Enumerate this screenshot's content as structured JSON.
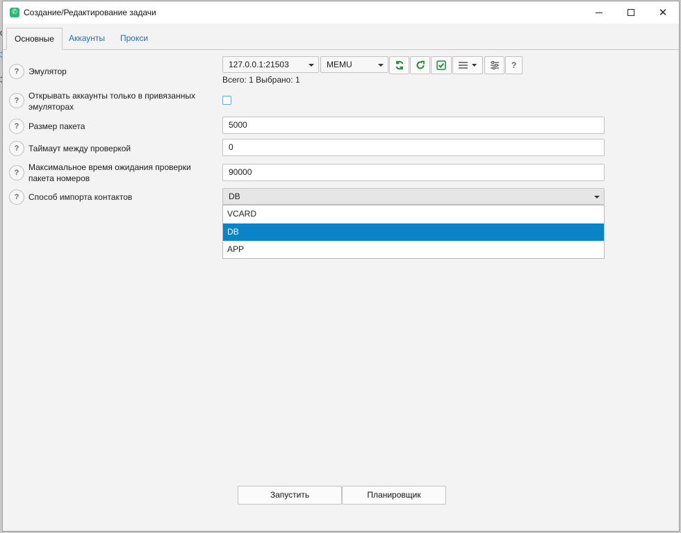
{
  "background": {
    "glyph_1": "ф",
    "glyph_2": "З",
    "glyph_3": "З"
  },
  "window": {
    "title": "Создание/Редактирование задачи"
  },
  "tabs": [
    {
      "label": "Основные",
      "active": true
    },
    {
      "label": "Аккаунты",
      "active": false
    },
    {
      "label": "Прокси",
      "active": false
    }
  ],
  "form": {
    "emulator": {
      "label": "Эмулятор",
      "address_value": "127.0.0.1:21503",
      "type_value": "MEMU",
      "summary": "Всего: 1 Выбрано: 1",
      "tools": [
        "refresh-all-icon",
        "reload-icon",
        "check-all-icon",
        "list-menu-icon",
        "settings-sliders-icon",
        "help-icon"
      ],
      "help_glyph": "?"
    },
    "bound_only": {
      "label": "Открывать аккаунты только в привязанных эмуляторах",
      "checked": false
    },
    "packet_size": {
      "label": "Размер пакета",
      "value": "5000"
    },
    "timeout": {
      "label": "Таймаут между проверкой",
      "value": "0"
    },
    "max_wait": {
      "label": "Максимальное время ожидания проверки пакета номеров",
      "value": "90000"
    },
    "import_method": {
      "label": "Способ импорта контактов",
      "value": "DB",
      "options": [
        "VCARD",
        "DB",
        "APP"
      ]
    }
  },
  "help_glyph": "?",
  "footer": {
    "start_label": "Запустить",
    "scheduler_label": "Планировщик"
  },
  "colors": {
    "accent": "#0a84c6",
    "tab_link": "#1b6fb8",
    "icon_green": "#1e8a3a"
  }
}
